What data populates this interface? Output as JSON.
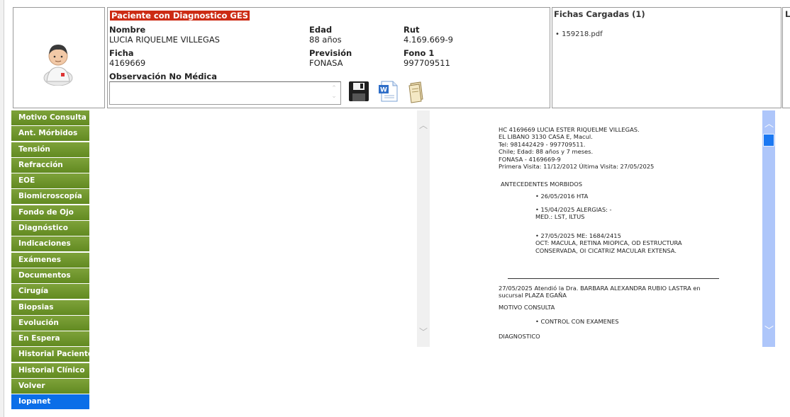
{
  "patient": {
    "ges_label": "Paciente con Diagnostico GES",
    "nombre_label": "Nombre",
    "nombre": "LUCIA RIQUELME VILLEGAS",
    "edad_label": "Edad",
    "edad": "88 años",
    "rut_label": "Rut",
    "rut": "4.169.669-9",
    "ficha_label": "Ficha",
    "ficha": "4169669",
    "prevision_label": "Previsión",
    "prevision": "FONASA",
    "fono_label": "Fono 1",
    "fono": "997709511",
    "observacion_label": "Observación No Médica",
    "observacion_value": ""
  },
  "fichas": {
    "title": "Fichas Cargadas (1)",
    "items": [
      "• 159218.pdf"
    ]
  },
  "extra_panel": {
    "title_initial": "L"
  },
  "sidebar": {
    "items": [
      "Motivo Consulta",
      "Ant. Mórbidos",
      "Tensión",
      "Refracción",
      "EOE",
      "Biomicroscopía",
      "Fondo de Ojo",
      "Diagnóstico",
      "Indicaciones",
      "Exámenes",
      "Documentos",
      "Cirugía",
      "Biopsias",
      "Evolución",
      "En Espera",
      "Historial Paciente",
      "Historial Clínico",
      "Volver",
      "Iopanet"
    ],
    "active_index": 18
  },
  "record": {
    "header_lines": [
      "HC 4169669 LUCIA ESTER RIQUELME VILLEGAS.",
      "EL LIBANO 3130 CASA E, Macul.",
      "Tel: 981442429 - 997709511.",
      "Chile; Edad: 88 años y 7 meses.",
      "FONASA - 4169669-9",
      "Primera Visita: 11/12/2012 Última Visita: 27/05/2025"
    ],
    "antecedentes_title": "ANTECEDENTES MORBIDOS",
    "ant1": "• 26/05/2016 HTA",
    "ant2_line1": "• 15/04/2025 ALERGIAS: -",
    "ant2_line2": "MED.: LST, ILTUS",
    "ant3_line1": "• 27/05/2025 ME: 1684/2415",
    "ant3_line2": "OCT: MACULA, RETINA MIOPICA, OD ESTRUCTURA",
    "ant3_line3": "CONSERVADA, OI CICATRIZ MACULAR EXTENSA.",
    "visit_line1": "27/05/2025 Atendió la Dra. BARBARA ALEXANDRA RUBIO LASTRA en",
    "visit_line2": "sucursal PLAZA EGAÑA",
    "motivo_title": "MOTIVO CONSULTA",
    "motivo_item": "• CONTROL CON EXAMENES",
    "diagnostico_title": "DIAGNOSTICO"
  },
  "colors": {
    "nav_green": "#6f9a2e",
    "nav_active_blue": "#0b6ee8",
    "ges_red": "#cc2b14",
    "scrollbar_blue": "#aec6fa"
  },
  "icons": [
    "doctor-avatar-icon",
    "save-icon",
    "word-document-icon",
    "notes-icon"
  ]
}
